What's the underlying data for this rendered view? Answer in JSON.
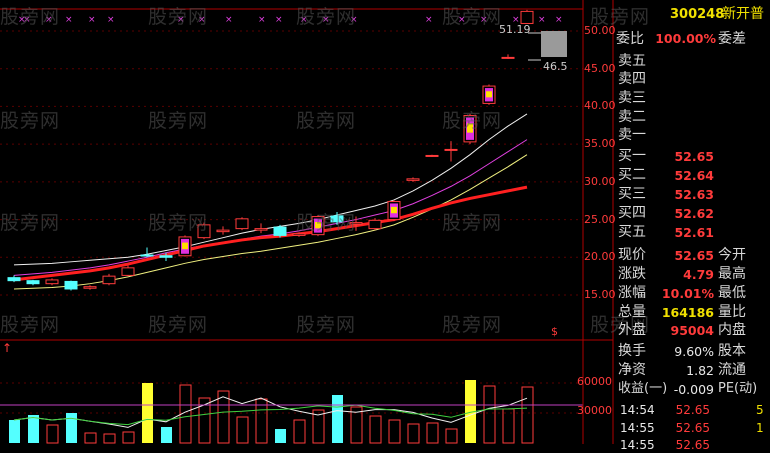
{
  "watermark": "股旁网",
  "stock": {
    "code": "300248",
    "name": "新开普"
  },
  "price_axis": {
    "labels": [
      "50.00",
      "45.00",
      "40.00",
      "35.00",
      "30.00",
      "25.00",
      "20.00",
      "15.00"
    ],
    "marker_high": "51.19",
    "marker_low": "46.5",
    "dollar": "$"
  },
  "volume_axis": {
    "labels": [
      "60000",
      "30000"
    ]
  },
  "quote_panel": {
    "weibi_label": "委比",
    "weibi_value": "100.00%",
    "weicha_label": "委差",
    "asks": [
      {
        "label": "卖五",
        "price": ""
      },
      {
        "label": "卖四",
        "price": ""
      },
      {
        "label": "卖三",
        "price": ""
      },
      {
        "label": "卖二",
        "price": ""
      },
      {
        "label": "卖一",
        "price": ""
      }
    ],
    "bids": [
      {
        "label": "买一",
        "price": "52.65"
      },
      {
        "label": "买二",
        "price": "52.64"
      },
      {
        "label": "买三",
        "price": "52.63"
      },
      {
        "label": "买四",
        "price": "52.62"
      },
      {
        "label": "买五",
        "price": "52.61"
      }
    ],
    "stats": [
      {
        "label": "现价",
        "value": "52.65",
        "label2": "今开",
        "color": "red"
      },
      {
        "label": "涨跌",
        "value": "4.79",
        "label2": "最高",
        "color": "red"
      },
      {
        "label": "涨幅",
        "value": "10.01%",
        "label2": "最低",
        "color": "red"
      },
      {
        "label": "总量",
        "value": "164186",
        "label2": "量比",
        "color": "yellow"
      },
      {
        "label": "外盘",
        "value": "95004",
        "label2": "内盘",
        "color": "red"
      }
    ],
    "stats2": [
      {
        "label": "换手",
        "value": "9.60%",
        "label2": "股本",
        "color": "white"
      },
      {
        "label": "净资",
        "value": "1.82",
        "label2": "流通",
        "color": "white"
      },
      {
        "label": "收益(一)",
        "value": "-0.009",
        "label2": "PE(动)",
        "color": "white"
      }
    ],
    "ticks": [
      {
        "time": "14:54",
        "price": "52.65",
        "vol": "5"
      },
      {
        "time": "14:55",
        "price": "52.65",
        "vol": "1"
      },
      {
        "time": "14:55",
        "price": "52.65",
        "vol": ""
      }
    ]
  },
  "chart_data": {
    "type": "candlestick",
    "ylim": [
      13,
      53
    ],
    "candles": [
      {
        "o": 17.3,
        "c": 16.9,
        "h": 17.6,
        "l": 16.7
      },
      {
        "o": 16.9,
        "c": 16.5,
        "h": 17.0,
        "l": 16.3
      },
      {
        "o": 16.5,
        "c": 17.0,
        "h": 17.2,
        "l": 16.3
      },
      {
        "o": 16.8,
        "c": 15.8,
        "h": 16.9,
        "l": 15.6
      },
      {
        "o": 15.9,
        "c": 16.1,
        "h": 16.3,
        "l": 15.7
      },
      {
        "o": 16.5,
        "c": 17.5,
        "h": 17.8,
        "l": 16.3
      },
      {
        "o": 17.6,
        "c": 18.6,
        "h": 18.9,
        "l": 17.5
      },
      {
        "o": 20.3,
        "c": 20.2,
        "h": 21.3,
        "l": 20.0
      },
      {
        "o": 20.2,
        "c": 20.0,
        "h": 20.6,
        "l": 19.5
      },
      {
        "o": 20.2,
        "c": 22.7,
        "h": 22.9,
        "l": 20.1
      },
      {
        "o": 22.6,
        "c": 24.3,
        "h": 24.6,
        "l": 22.4
      },
      {
        "o": 23.4,
        "c": 23.6,
        "h": 24.1,
        "l": 23.0
      },
      {
        "o": 23.8,
        "c": 25.1,
        "h": 25.3,
        "l": 23.6
      },
      {
        "o": 23.6,
        "c": 23.8,
        "h": 24.5,
        "l": 23.2
      },
      {
        "o": 24.0,
        "c": 22.9,
        "h": 24.3,
        "l": 22.6
      },
      {
        "o": 22.9,
        "c": 23.1,
        "h": 23.3,
        "l": 22.7
      },
      {
        "o": 23.0,
        "c": 25.4,
        "h": 25.6,
        "l": 22.8
      },
      {
        "o": 25.5,
        "c": 24.7,
        "h": 26.0,
        "l": 24.3
      },
      {
        "o": 24.4,
        "c": 24.6,
        "h": 25.4,
        "l": 23.5
      },
      {
        "o": 23.8,
        "c": 24.9,
        "h": 25.2,
        "l": 23.6
      },
      {
        "o": 25.0,
        "c": 27.4,
        "h": 27.6,
        "l": 24.8
      },
      {
        "o": 30.2,
        "c": 30.4,
        "h": 30.6,
        "l": 30.0
      },
      {
        "o": 33.4,
        "c": 33.5,
        "h": 33.6,
        "l": 33.3
      },
      {
        "o": 34.2,
        "c": 34.3,
        "h": 35.4,
        "l": 32.7
      },
      {
        "o": 35.3,
        "c": 38.8,
        "h": 39.0,
        "l": 35.0
      },
      {
        "o": 40.4,
        "c": 42.7,
        "h": 42.9,
        "l": 40.2
      },
      {
        "o": 46.5,
        "c": 46.5,
        "h": 46.9,
        "l": 46.3
      },
      {
        "o": 51.0,
        "c": 52.6,
        "h": 52.8,
        "l": 51.0
      }
    ],
    "ma_red": [
      17.0,
      17.3,
      17.6,
      17.9,
      18.2,
      18.6,
      19.1,
      19.7,
      20.3,
      20.9,
      21.5,
      21.9,
      22.3,
      22.6,
      22.8,
      23.1,
      23.4,
      23.8,
      24.2,
      24.6,
      25.0,
      25.7,
      26.5,
      27.2,
      27.8,
      28.3,
      28.8,
      29.3
    ],
    "ma_white": [
      19.0,
      19.1,
      19.2,
      19.4,
      19.6,
      19.8,
      20.0,
      20.4,
      20.9,
      21.4,
      22.0,
      22.6,
      23.2,
      23.7,
      24.1,
      24.5,
      25.0,
      25.6,
      26.2,
      26.8,
      27.6,
      28.8,
      30.2,
      31.8,
      33.6,
      35.6,
      37.4,
      39.0
    ],
    "ma_purple": [
      17.6,
      17.8,
      18.0,
      18.3,
      18.6,
      19.0,
      19.5,
      20.0,
      20.6,
      21.1,
      21.6,
      22.0,
      22.4,
      22.8,
      23.1,
      23.5,
      24.0,
      24.5,
      25.0,
      25.6,
      26.2,
      27.1,
      28.2,
      29.4,
      30.8,
      32.4,
      34.0,
      35.6
    ],
    "ma_yellow": [
      15.8,
      15.9,
      16.0,
      16.2,
      16.5,
      16.9,
      17.4,
      18.0,
      18.6,
      19.2,
      19.7,
      20.1,
      20.5,
      20.8,
      21.2,
      21.6,
      22.0,
      22.5,
      23.0,
      23.6,
      24.3,
      25.3,
      26.4,
      27.6,
      29.0,
      30.5,
      32.0,
      33.6
    ],
    "volumes": [
      23000,
      28000,
      18000,
      30000,
      10000,
      9000,
      11000,
      60000,
      16000,
      58000,
      45000,
      52000,
      26000,
      44000,
      14000,
      23000,
      33000,
      48000,
      36000,
      27000,
      23000,
      19000,
      20000,
      14000,
      63000,
      57000,
      34000,
      56000
    ]
  }
}
